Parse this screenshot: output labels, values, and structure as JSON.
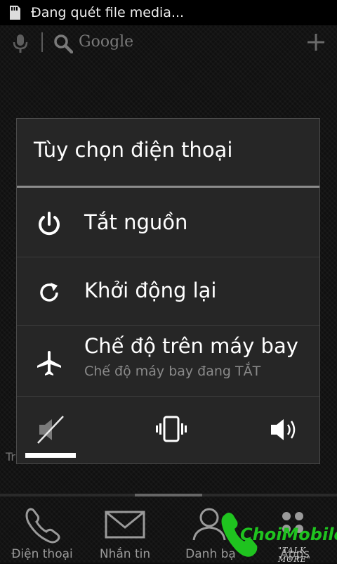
{
  "status_bar": {
    "notification_text": "Đang quét file media..."
  },
  "search_bar": {
    "brand": "Google"
  },
  "dialog": {
    "title": "Tùy chọn điện thoại",
    "items": [
      {
        "label": "Tắt nguồn",
        "icon": "power-icon"
      },
      {
        "label": "Khởi động lại",
        "icon": "restart-icon"
      },
      {
        "label": "Chế độ trên máy bay",
        "sublabel": "Chế độ máy bay đang TẮT",
        "icon": "airplane-icon"
      }
    ],
    "sound_modes": [
      "silent",
      "vibrate",
      "sound-on"
    ],
    "selected_sound_mode": "silent"
  },
  "background_peek_text": "Tr",
  "dock": {
    "items": [
      {
        "label": "Điện thoại",
        "icon": "phone-icon"
      },
      {
        "label": "Nhắn tin",
        "icon": "envelope-icon"
      },
      {
        "label": "Danh bạ",
        "icon": "contact-icon"
      },
      {
        "label": "Apps",
        "icon": "apps-grid-icon"
      }
    ]
  },
  "watermark": {
    "brand": "ChoiMobile",
    "tagline": "\"TALK MORE\""
  },
  "colors": {
    "dialog_bg": "#262626",
    "watermark_green": "#1fc31f"
  }
}
